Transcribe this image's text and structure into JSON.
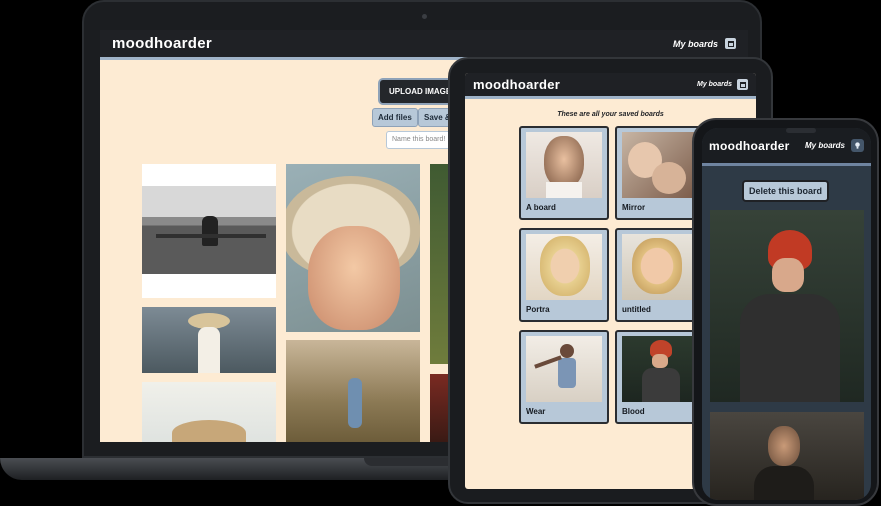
{
  "brand": {
    "logo": "moodhoarder",
    "my_boards": "My boards"
  },
  "laptop": {
    "upload_button": "UPLOAD IMAGES H",
    "add_files_button": "Add files",
    "save_button": "Save &",
    "board_name_placeholder": "Name this board!"
  },
  "tablet": {
    "heading": "These are all your saved boards",
    "boards": [
      {
        "label": "A board"
      },
      {
        "label": "Mirror"
      },
      {
        "label": "Portra"
      },
      {
        "label": "untitled"
      },
      {
        "label": "Wear"
      },
      {
        "label": "Blood"
      }
    ]
  },
  "phone": {
    "delete_button": "Delete this board"
  },
  "colors": {
    "cream": "#fdebd3",
    "navbar": "#1f2125",
    "accent_blue": "#b7c8d8",
    "phone_bg": "#2e3a46"
  },
  "icons": {
    "boards": "boards-icon",
    "theme": "lightbulb-icon"
  }
}
